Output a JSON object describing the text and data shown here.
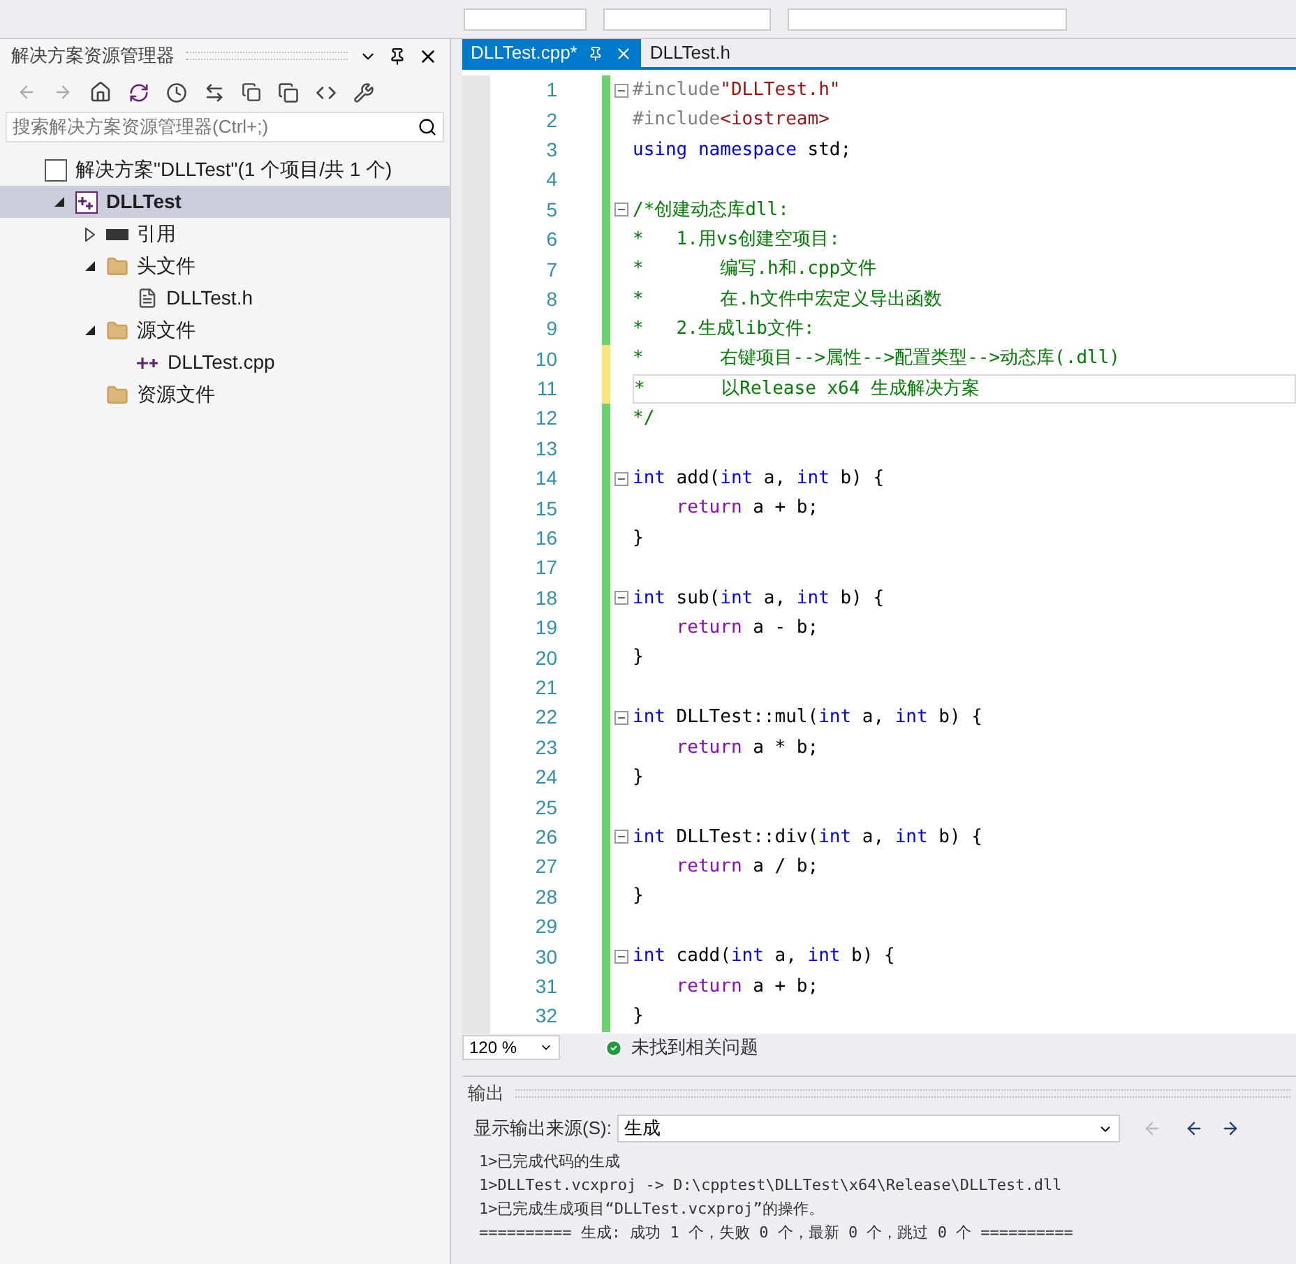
{
  "explorer": {
    "title": "解决方案资源管理器",
    "search": {
      "placeholder": "搜索解决方案资源管理器(Ctrl+;)"
    },
    "tree": [
      {
        "label": "解决方案\"DLLTest\"(1 个项目/共 1 个)",
        "kind": "solution",
        "selected": false,
        "children": [
          {
            "label": "DLLTest",
            "kind": "project",
            "selected": true,
            "expanded": true,
            "children": [
              {
                "label": "引用",
                "kind": "refs",
                "selected": false,
                "expanded": false
              },
              {
                "label": "头文件",
                "kind": "filter",
                "selected": false,
                "expanded": true,
                "children": [
                  {
                    "label": "DLLTest.h",
                    "kind": "header",
                    "selected": false
                  }
                ]
              },
              {
                "label": "源文件",
                "kind": "filter",
                "selected": false,
                "expanded": true,
                "children": [
                  {
                    "label": "DLLTest.cpp",
                    "kind": "source",
                    "selected": false
                  }
                ]
              },
              {
                "label": "资源文件",
                "kind": "filter",
                "selected": false
              }
            ]
          }
        ]
      }
    ]
  },
  "tabs": [
    {
      "label": "DLLTest.cpp*",
      "selected": true
    },
    {
      "label": "DLLTest.h",
      "selected": false
    }
  ],
  "code": [
    {
      "n": "1",
      "fold": true,
      "modified": false,
      "current": false,
      "tokens": [
        {
          "kind": "pre",
          "t": "#include"
        },
        {
          "kind": "str",
          "t": "\"DLLTest.h\""
        }
      ]
    },
    {
      "n": "2",
      "fold": false,
      "modified": false,
      "current": false,
      "tokens": [
        {
          "kind": "pre",
          "t": "#include"
        },
        {
          "kind": "str",
          "t": "<iostream>"
        }
      ]
    },
    {
      "n": "3",
      "fold": false,
      "modified": false,
      "current": false,
      "tokens": [
        {
          "kind": "kw",
          "t": "using"
        },
        {
          "kind": "kw",
          "t": " namespace"
        },
        {
          "kind": "plain",
          "t": " std;"
        }
      ]
    },
    {
      "n": "4",
      "fold": false,
      "modified": false,
      "current": false
    },
    {
      "n": "5",
      "fold": true,
      "modified": false,
      "current": false,
      "tokens": [
        {
          "kind": "cmt",
          "t": "/*创建动态库dll:"
        }
      ]
    },
    {
      "n": "6",
      "fold": false,
      "modified": false,
      "current": false,
      "tokens": [
        {
          "kind": "cmt",
          "t": "*   1.用vs创建空项目:"
        }
      ]
    },
    {
      "n": "7",
      "fold": false,
      "modified": false,
      "current": false,
      "tokens": [
        {
          "kind": "cmt",
          "t": "*       编写.h和.cpp文件"
        }
      ]
    },
    {
      "n": "8",
      "fold": false,
      "modified": false,
      "current": false,
      "tokens": [
        {
          "kind": "cmt",
          "t": "*       在.h文件中宏定义导出函数"
        }
      ]
    },
    {
      "n": "9",
      "fold": false,
      "modified": false,
      "current": false,
      "tokens": [
        {
          "kind": "cmt",
          "t": "*   2.生成lib文件:"
        }
      ]
    },
    {
      "n": "10",
      "fold": false,
      "modified": true,
      "current": false,
      "tokens": [
        {
          "kind": "cmt",
          "t": "*       右键项目-->属性-->配置类型-->动态库(.dll)"
        }
      ]
    },
    {
      "n": "11",
      "fold": false,
      "modified": true,
      "current": true,
      "tokens": [
        {
          "kind": "cmt",
          "t": "*       以Release x64 生成解决方案"
        }
      ]
    },
    {
      "n": "12",
      "fold": false,
      "modified": false,
      "current": false,
      "tokens": [
        {
          "kind": "cmt",
          "t": "*/"
        }
      ]
    },
    {
      "n": "13",
      "fold": false,
      "modified": false,
      "current": false
    },
    {
      "n": "14",
      "fold": true,
      "modified": false,
      "current": false,
      "tokens": [
        {
          "kind": "kw",
          "t": "int"
        },
        {
          "kind": "plain",
          "t": " add("
        },
        {
          "kind": "kw",
          "t": "int"
        },
        {
          "kind": "plain",
          "t": " a, "
        },
        {
          "kind": "kw",
          "t": "int"
        },
        {
          "kind": "plain",
          "t": " b) {"
        }
      ]
    },
    {
      "n": "15",
      "fold": false,
      "modified": false,
      "current": false,
      "tokens": [
        {
          "kind": "ret",
          "t": "    return"
        },
        {
          "kind": "plain",
          "t": " a + b;"
        }
      ]
    },
    {
      "n": "16",
      "fold": false,
      "modified": false,
      "current": false,
      "tokens": [
        {
          "kind": "plain",
          "t": "}"
        }
      ]
    },
    {
      "n": "17",
      "fold": false,
      "modified": false,
      "current": false
    },
    {
      "n": "18",
      "fold": true,
      "modified": false,
      "current": false,
      "tokens": [
        {
          "kind": "kw",
          "t": "int"
        },
        {
          "kind": "plain",
          "t": " sub("
        },
        {
          "kind": "kw",
          "t": "int"
        },
        {
          "kind": "plain",
          "t": " a, "
        },
        {
          "kind": "kw",
          "t": "int"
        },
        {
          "kind": "plain",
          "t": " b) {"
        }
      ]
    },
    {
      "n": "19",
      "fold": false,
      "modified": false,
      "current": false,
      "tokens": [
        {
          "kind": "ret",
          "t": "    return"
        },
        {
          "kind": "plain",
          "t": " a - b;"
        }
      ]
    },
    {
      "n": "20",
      "fold": false,
      "modified": false,
      "current": false,
      "tokens": [
        {
          "kind": "plain",
          "t": "}"
        }
      ]
    },
    {
      "n": "21",
      "fold": false,
      "modified": false,
      "current": false
    },
    {
      "n": "22",
      "fold": true,
      "modified": false,
      "current": false,
      "tokens": [
        {
          "kind": "kw",
          "t": "int"
        },
        {
          "kind": "plain",
          "t": " DLLTest::mul("
        },
        {
          "kind": "kw",
          "t": "int"
        },
        {
          "kind": "plain",
          "t": " a, "
        },
        {
          "kind": "kw",
          "t": "int"
        },
        {
          "kind": "plain",
          "t": " b) {"
        }
      ]
    },
    {
      "n": "23",
      "fold": false,
      "modified": false,
      "current": false,
      "tokens": [
        {
          "kind": "ret",
          "t": "    return"
        },
        {
          "kind": "plain",
          "t": " a * b;"
        }
      ]
    },
    {
      "n": "24",
      "fold": false,
      "modified": false,
      "current": false,
      "tokens": [
        {
          "kind": "plain",
          "t": "}"
        }
      ]
    },
    {
      "n": "25",
      "fold": false,
      "modified": false,
      "current": false
    },
    {
      "n": "26",
      "fold": true,
      "modified": false,
      "current": false,
      "tokens": [
        {
          "kind": "kw",
          "t": "int"
        },
        {
          "kind": "plain",
          "t": " DLLTest::div("
        },
        {
          "kind": "kw",
          "t": "int"
        },
        {
          "kind": "plain",
          "t": " a, "
        },
        {
          "kind": "kw",
          "t": "int"
        },
        {
          "kind": "plain",
          "t": " b) {"
        }
      ]
    },
    {
      "n": "27",
      "fold": false,
      "modified": false,
      "current": false,
      "tokens": [
        {
          "kind": "ret",
          "t": "    return"
        },
        {
          "kind": "plain",
          "t": " a / b;"
        }
      ]
    },
    {
      "n": "28",
      "fold": false,
      "modified": false,
      "current": false,
      "tokens": [
        {
          "kind": "plain",
          "t": "}"
        }
      ]
    },
    {
      "n": "29",
      "fold": false,
      "modified": false,
      "current": false
    },
    {
      "n": "30",
      "fold": true,
      "modified": false,
      "current": false,
      "tokens": [
        {
          "kind": "kw",
          "t": "int"
        },
        {
          "kind": "plain",
          "t": " cadd("
        },
        {
          "kind": "kw",
          "t": "int"
        },
        {
          "kind": "plain",
          "t": " a, "
        },
        {
          "kind": "kw",
          "t": "int"
        },
        {
          "kind": "plain",
          "t": " b) {"
        }
      ]
    },
    {
      "n": "31",
      "fold": false,
      "modified": false,
      "current": false,
      "tokens": [
        {
          "kind": "ret",
          "t": "    return"
        },
        {
          "kind": "plain",
          "t": " a + b;"
        }
      ]
    },
    {
      "n": "32",
      "fold": false,
      "modified": false,
      "current": false,
      "tokens": [
        {
          "kind": "plain",
          "t": "}"
        }
      ]
    }
  ],
  "status": {
    "zoom": "120 %",
    "message": "未找到相关问题"
  },
  "output": {
    "title": "输出",
    "source_label": "显示输出来源(S):",
    "source": "生成",
    "lines": [
      "1>已完成代码的生成",
      "1>DLLTest.vcxproj -> D:\\cpptest\\DLLTest\\x64\\Release\\DLLTest.dll",
      "1>已完成生成项目“DLLTest.vcxproj”的操作。",
      "========== 生成: 成功 1 个，失败 0 个，最新 0 个，跳过 0 个 =========="
    ]
  }
}
